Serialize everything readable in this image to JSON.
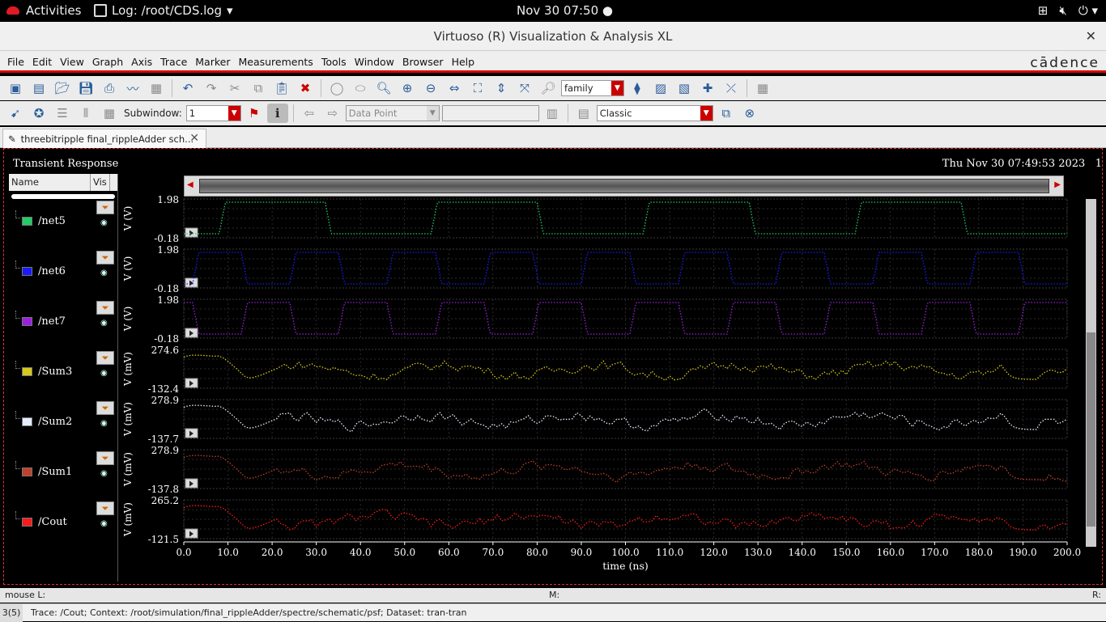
{
  "gnome": {
    "activities": "Activities",
    "app": "Log: /root/CDS.log",
    "clock": "Nov 30  07:50"
  },
  "window": {
    "title": "Virtuoso (R) Visualization & Analysis XL",
    "close": "✕"
  },
  "menu": {
    "items": [
      "File",
      "Edit",
      "View",
      "Graph",
      "Axis",
      "Trace",
      "Marker",
      "Measurements",
      "Tools",
      "Window",
      "Browser",
      "Help"
    ],
    "logo": "cādence"
  },
  "toolbar": {
    "family_value": "family",
    "subwindow_label": "Subwindow:",
    "subwindow_value": "1",
    "datapoint_value": "Data Point",
    "style_value": "Classic"
  },
  "tab": {
    "label": "threebitripple final_rippleAdder sch...",
    "close": "✕"
  },
  "plot": {
    "title": "Transient Response",
    "datetime": "Thu Nov 30 07:49:53 2023",
    "page_index": "1"
  },
  "legend": {
    "name_header": "Name",
    "vis_header": "Vis"
  },
  "colors": {
    "menu_accent": "#dd0000",
    "plot_bg": "#000000",
    "grid": "#3a3a3a"
  },
  "chart_data": {
    "type": "line",
    "xlabel": "time (ns)",
    "xlim": [
      0,
      200
    ],
    "xticks": [
      "0.0",
      "10.0",
      "20.0",
      "30.0",
      "40.0",
      "50.0",
      "60.0",
      "70.0",
      "80.0",
      "90.0",
      "100.0",
      "110.0",
      "120.0",
      "130.0",
      "140.0",
      "150.0",
      "160.0",
      "170.0",
      "180.0",
      "190.0",
      "200.0"
    ],
    "series": [
      {
        "name": "/net5",
        "color": "#22cc66",
        "ylabel": "V (V)",
        "ymax": "1.98",
        "ymin": "-0.18",
        "kind": "digital",
        "period": 48,
        "phase": 8
      },
      {
        "name": "/net6",
        "color": "#1a1aff",
        "ylabel": "V (V)",
        "ymax": "1.98",
        "ymin": "-0.18",
        "kind": "digital",
        "period": 22,
        "phase": 2
      },
      {
        "name": "/net7",
        "color": "#9a22dd",
        "ylabel": "V (V)",
        "ymax": "1.98",
        "ymin": "-0.18",
        "kind": "digital",
        "period": 22,
        "phase": 13
      },
      {
        "name": "/Sum3",
        "color": "#d8c81a",
        "ylabel": "V (mV)",
        "ymax": "274.6",
        "ymin": "-132.4",
        "kind": "analog"
      },
      {
        "name": "/Sum2",
        "color": "#e4ecff",
        "ylabel": "V (mV)",
        "ymax": "278.9",
        "ymin": "-137.7",
        "kind": "analog"
      },
      {
        "name": "/Sum1",
        "color": "#c0402a",
        "ylabel": "V (mV)",
        "ymax": "278.9",
        "ymin": "-137.8",
        "kind": "analog"
      },
      {
        "name": "/Cout",
        "color": "#ff1a1a",
        "ylabel": "V (mV)",
        "ymax": "265.2",
        "ymin": "-121.5",
        "kind": "analog"
      }
    ]
  },
  "status": {
    "mouse_l": "mouse L:",
    "mouse_m": "M:",
    "mouse_r": "R:",
    "index": "3(5)",
    "message": "Trace: /Cout; Context: /root/simulation/final_rippleAdder/spectre/schematic/psf; Dataset: tran-tran"
  }
}
